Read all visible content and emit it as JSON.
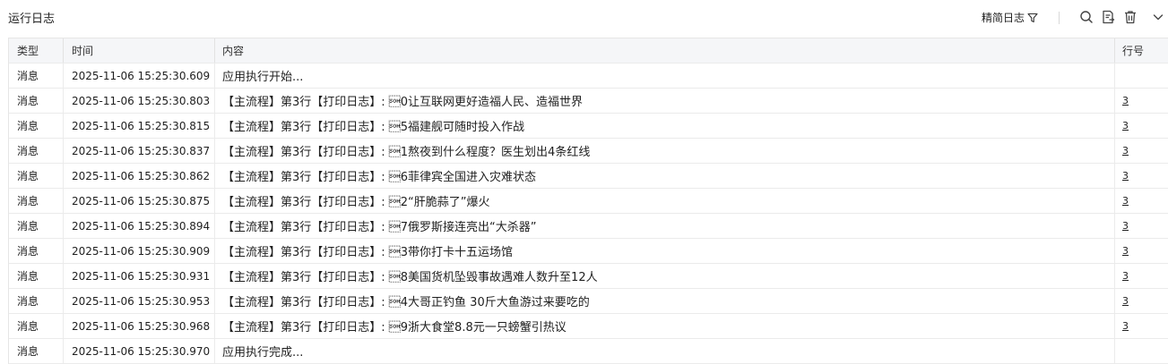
{
  "header": {
    "title": "运行日志",
    "mode_label": "精简日志"
  },
  "table": {
    "columns": {
      "type": "类型",
      "time": "时间",
      "content": "内容",
      "line": "行号"
    },
    "rows": [
      {
        "type": "消息",
        "time": "2025-11-06 15:25:30.609",
        "content": "应用执行开始...",
        "line": ""
      },
      {
        "type": "消息",
        "time": "2025-11-06 15:25:30.803",
        "content": "【主流程】第3行【打印日志】: \u00010让互联网更好造福人民、造福世界",
        "line": "3"
      },
      {
        "type": "消息",
        "time": "2025-11-06 15:25:30.815",
        "content": "【主流程】第3行【打印日志】: \u00015福建舰可随时投入作战",
        "line": "3"
      },
      {
        "type": "消息",
        "time": "2025-11-06 15:25:30.837",
        "content": "【主流程】第3行【打印日志】: \u00011熬夜到什么程度？医生划出4条红线",
        "line": "3"
      },
      {
        "type": "消息",
        "time": "2025-11-06 15:25:30.862",
        "content": "【主流程】第3行【打印日志】: \u00016菲律宾全国进入灾难状态",
        "line": "3"
      },
      {
        "type": "消息",
        "time": "2025-11-06 15:25:30.875",
        "content": "【主流程】第3行【打印日志】: \u00012“肝脆蒜了”爆火",
        "line": "3"
      },
      {
        "type": "消息",
        "time": "2025-11-06 15:25:30.894",
        "content": "【主流程】第3行【打印日志】: \u00017俄罗斯接连亮出“大杀器”",
        "line": "3"
      },
      {
        "type": "消息",
        "time": "2025-11-06 15:25:30.909",
        "content": "【主流程】第3行【打印日志】: \u00013带你打卡十五运场馆",
        "line": "3"
      },
      {
        "type": "消息",
        "time": "2025-11-06 15:25:30.931",
        "content": "【主流程】第3行【打印日志】: \u00018美国货机坠毁事故遇难人数升至12人",
        "line": "3"
      },
      {
        "type": "消息",
        "time": "2025-11-06 15:25:30.953",
        "content": "【主流程】第3行【打印日志】: \u00014大哥正钓鱼 30斤大鱼游过来要吃的",
        "line": "3"
      },
      {
        "type": "消息",
        "time": "2025-11-06 15:25:30.968",
        "content": "【主流程】第3行【打印日志】: \u00019浙大食堂8.8元一只螃蟹引热议",
        "line": "3"
      },
      {
        "type": "消息",
        "time": "2025-11-06 15:25:30.970",
        "content": "应用执行完成...",
        "line": ""
      }
    ]
  }
}
